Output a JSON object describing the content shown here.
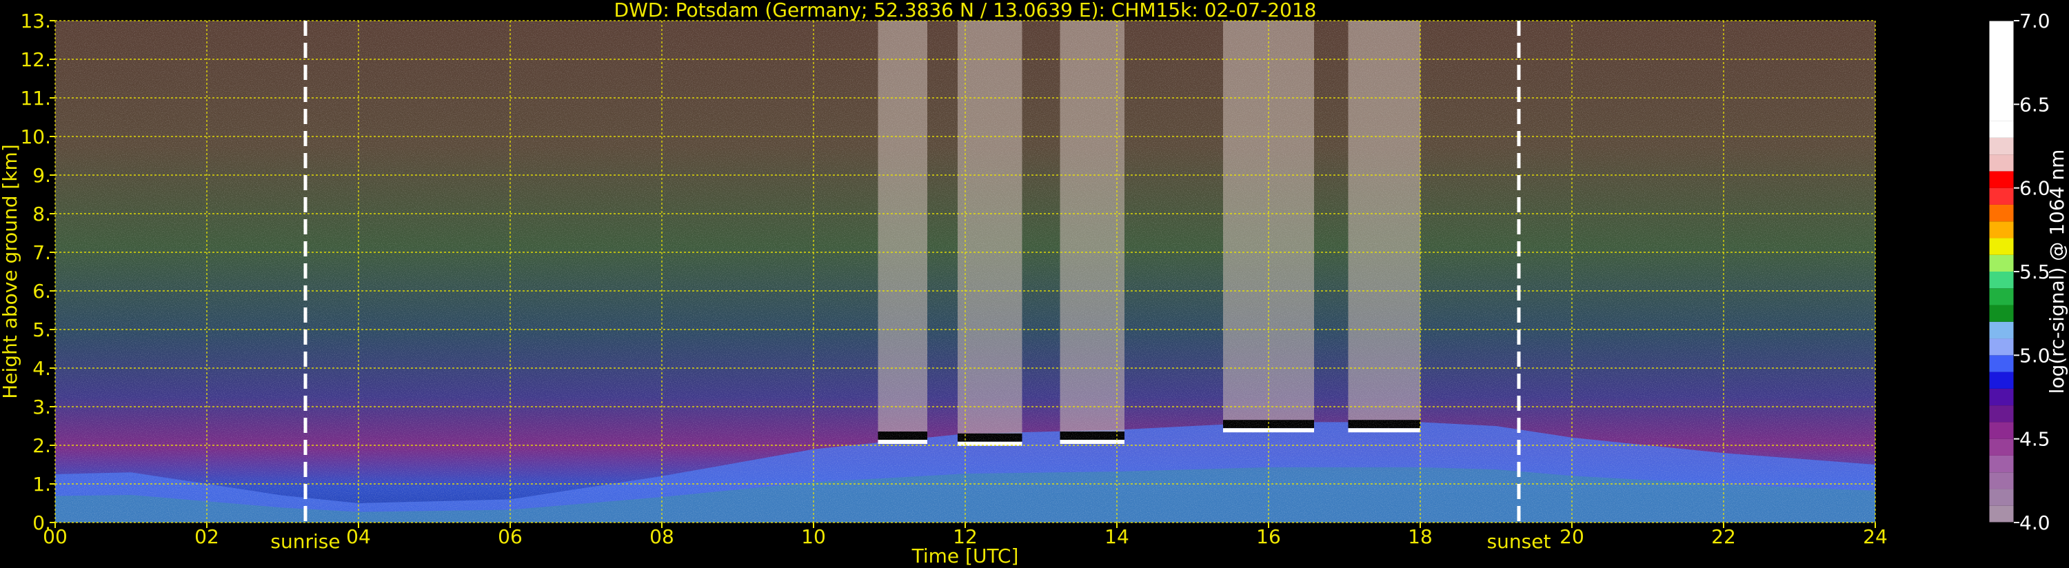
{
  "chart_data": {
    "type": "heatmap",
    "title": "DWD: Potsdam (Germany; 52.3836 N / 13.0639 E):    CHM15k: 02-07-2018",
    "xlabel": "Time [UTC]",
    "ylabel": "Height above ground [km]",
    "xlim": [
      0,
      24
    ],
    "ylim": [
      0,
      13
    ],
    "x_ticks": [
      "00",
      "02",
      "04",
      "06",
      "08",
      "10",
      "12",
      "14",
      "16",
      "18",
      "20",
      "22",
      "24"
    ],
    "y_ticks": [
      "0.",
      "1.",
      "2.",
      "3.",
      "4.",
      "5.",
      "6.",
      "7.",
      "8.",
      "9.",
      "10.",
      "11.",
      "12.",
      "13."
    ],
    "grid": true,
    "annotations": [
      {
        "label": "sunrise",
        "x": 3.3
      },
      {
        "label": "sunset",
        "x": 19.3
      }
    ],
    "colorbar": {
      "label": "log(rc-signal) @ 1064 nm",
      "range": [
        4.0,
        7.0
      ],
      "ticks": [
        "4.0",
        "4.5",
        "5.0",
        "5.5",
        "6.0",
        "6.5",
        "7.0"
      ],
      "levels": [
        {
          "from": 4.0,
          "to": 4.1,
          "color": "#a890a8"
        },
        {
          "from": 4.1,
          "to": 4.2,
          "color": "#a080a8"
        },
        {
          "from": 4.2,
          "to": 4.3,
          "color": "#a070a8"
        },
        {
          "from": 4.3,
          "to": 4.4,
          "color": "#a060a8"
        },
        {
          "from": 4.4,
          "to": 4.5,
          "color": "#983f98"
        },
        {
          "from": 4.5,
          "to": 4.6,
          "color": "#8e2a90"
        },
        {
          "from": 4.6,
          "to": 4.7,
          "color": "#6a1a90"
        },
        {
          "from": 4.7,
          "to": 4.8,
          "color": "#5010a8"
        },
        {
          "from": 4.8,
          "to": 4.9,
          "color": "#1818e0"
        },
        {
          "from": 4.9,
          "to": 5.0,
          "color": "#4060f8"
        },
        {
          "from": 5.0,
          "to": 5.1,
          "color": "#90a8f8"
        },
        {
          "from": 5.1,
          "to": 5.2,
          "color": "#80b8f0"
        },
        {
          "from": 5.2,
          "to": 5.3,
          "color": "#109020"
        },
        {
          "from": 5.3,
          "to": 5.4,
          "color": "#20b040"
        },
        {
          "from": 5.4,
          "to": 5.5,
          "color": "#40d880"
        },
        {
          "from": 5.5,
          "to": 5.6,
          "color": "#a0f060"
        },
        {
          "from": 5.6,
          "to": 5.7,
          "color": "#f0f000"
        },
        {
          "from": 5.7,
          "to": 5.8,
          "color": "#ffb000"
        },
        {
          "from": 5.8,
          "to": 5.9,
          "color": "#ff7000"
        },
        {
          "from": 5.9,
          "to": 6.0,
          "color": "#ff3030"
        },
        {
          "from": 6.0,
          "to": 6.1,
          "color": "#ff0000"
        },
        {
          "from": 6.1,
          "to": 6.2,
          "color": "#f0c0c0"
        },
        {
          "from": 6.2,
          "to": 6.3,
          "color": "#f0d0d0"
        },
        {
          "from": 6.3,
          "to": 6.4,
          "color": "#ffffff"
        },
        {
          "from": 6.4,
          "to": 7.0,
          "color": "#ffffff"
        }
      ]
    },
    "cloud_base_layers": [
      {
        "x_start": 10.85,
        "x_end": 11.5,
        "height_km": 2.25
      },
      {
        "x_start": 11.9,
        "x_end": 12.75,
        "height_km": 2.2
      },
      {
        "x_start": 13.25,
        "x_end": 14.1,
        "height_km": 2.25
      },
      {
        "x_start": 15.4,
        "x_end": 16.6,
        "height_km": 2.55
      },
      {
        "x_start": 17.05,
        "x_end": 18.0,
        "height_km": 2.55
      }
    ],
    "mixing_layer_top_km": [
      {
        "x": 0,
        "y": 1.25
      },
      {
        "x": 1,
        "y": 1.3
      },
      {
        "x": 2,
        "y": 1.0
      },
      {
        "x": 3,
        "y": 0.7
      },
      {
        "x": 4,
        "y": 0.5
      },
      {
        "x": 6,
        "y": 0.6
      },
      {
        "x": 8,
        "y": 1.2
      },
      {
        "x": 10,
        "y": 1.9
      },
      {
        "x": 12,
        "y": 2.3
      },
      {
        "x": 14,
        "y": 2.4
      },
      {
        "x": 16,
        "y": 2.6
      },
      {
        "x": 18,
        "y": 2.6
      },
      {
        "x": 19,
        "y": 2.5
      },
      {
        "x": 20,
        "y": 2.2
      },
      {
        "x": 22,
        "y": 1.8
      },
      {
        "x": 24,
        "y": 1.5
      }
    ],
    "colors": {
      "axis_text": "#f0e800",
      "grid": "#f0e800",
      "background": "#000000",
      "marker": "#ffffff"
    }
  }
}
